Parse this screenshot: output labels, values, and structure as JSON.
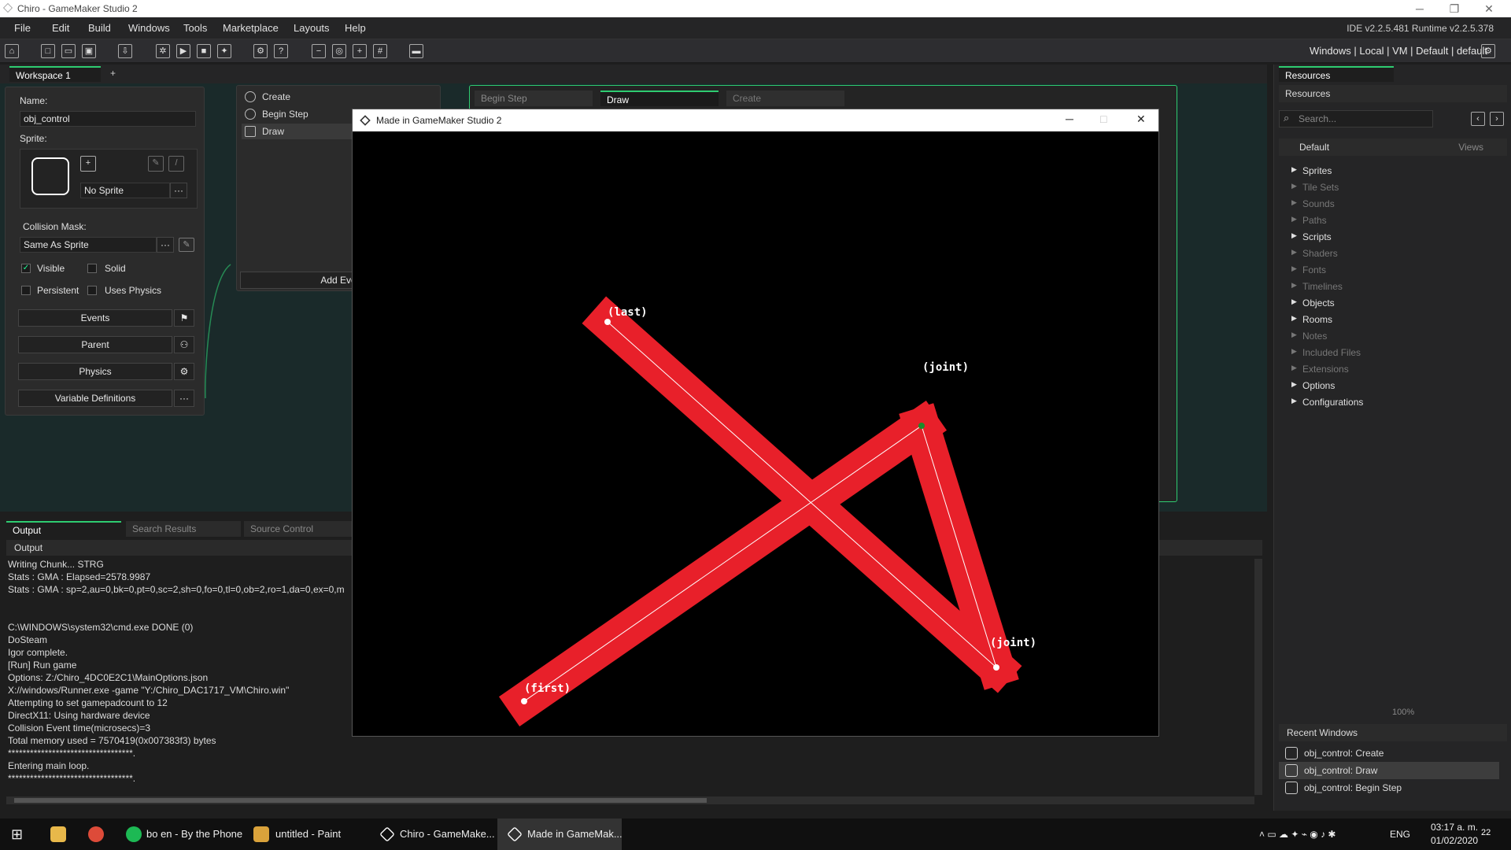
{
  "title_bar": {
    "title": "Chiro - GameMaker Studio 2",
    "minimize": "─",
    "maximize": "❐",
    "close": "✕"
  },
  "menu": {
    "items": [
      "File",
      "Edit",
      "Build",
      "Windows",
      "Tools",
      "Marketplace",
      "Layouts",
      "Help"
    ],
    "version": "IDE v2.2.5.481  Runtime v2.2.5.378"
  },
  "toolbar": {
    "target": "Windows  |  Local  |  VM  |  Default  |  default"
  },
  "workspace_tab": {
    "label": "Workspace 1",
    "add": "+"
  },
  "object_editor": {
    "name_label": "Name:",
    "name_value": "obj_control",
    "sprite_label": "Sprite:",
    "sprite_value": "No Sprite",
    "mask_label": "Collision Mask:",
    "mask_value": "Same As Sprite",
    "visible": "Visible",
    "solid": "Solid",
    "persistent": "Persistent",
    "uses_physics": "Uses Physics",
    "events_btn": "Events",
    "parent_btn": "Parent",
    "physics_btn": "Physics",
    "vardefs_btn": "Variable Definitions",
    "more": "···"
  },
  "events_list": {
    "items": [
      "Create",
      "Begin Step",
      "Draw"
    ],
    "add_event": "Add Eve"
  },
  "code_tabs": [
    {
      "label": "Begin Step"
    },
    {
      "label": "Draw"
    },
    {
      "label": "Create"
    }
  ],
  "game_window": {
    "title": "Made in GameMaker Studio 2",
    "labels": {
      "last": "(last)",
      "joint1": "(joint)",
      "joint2": "(joint)",
      "first": "(first)"
    },
    "shape_color": "#e8202a"
  },
  "output_panel": {
    "tabs": [
      "Output",
      "Search Results",
      "Source Control"
    ],
    "header": "Output",
    "lines": [
      "Writing Chunk... STRG",
      "Stats : GMA : Elapsed=2578.9987",
      "Stats : GMA : sp=2,au=0,bk=0,pt=0,sc=2,sh=0,fo=0,tl=0,ob=2,ro=1,da=0,ex=0,m",
      "",
      "",
      "C:\\WINDOWS\\system32\\cmd.exe DONE (0)",
      "DoSteam",
      "Igor complete.",
      "[Run] Run game",
      "Options: Z:/Chiro_4DC0E2C1\\MainOptions.json",
      "X://windows/Runner.exe  -game \"Y:/Chiro_DAC1717_VM\\Chiro.win\"",
      "Attempting to set gamepadcount to 12",
      "DirectX11: Using hardware device",
      "Collision Event time(microsecs)=3",
      "Total memory used = 7570419(0x007383f3) bytes",
      "**********************************.",
      "Entering main loop.",
      "**********************************."
    ]
  },
  "resources": {
    "tab": "Resources",
    "header": "Resources",
    "search_placeholder": "Search...",
    "group": "Default",
    "views": "Views",
    "items": [
      {
        "label": "Sprites",
        "on": true
      },
      {
        "label": "Tile Sets",
        "on": false
      },
      {
        "label": "Sounds",
        "on": false
      },
      {
        "label": "Paths",
        "on": false
      },
      {
        "label": "Scripts",
        "on": true
      },
      {
        "label": "Shaders",
        "on": false
      },
      {
        "label": "Fonts",
        "on": false
      },
      {
        "label": "Timelines",
        "on": false
      },
      {
        "label": "Objects",
        "on": true
      },
      {
        "label": "Rooms",
        "on": true
      },
      {
        "label": "Notes",
        "on": false
      },
      {
        "label": "Included Files",
        "on": false
      },
      {
        "label": "Extensions",
        "on": false
      },
      {
        "label": "Options",
        "on": true
      },
      {
        "label": "Configurations",
        "on": true
      }
    ],
    "zoom": "100%",
    "recent_header": "Recent Windows",
    "recent": [
      "obj_control: Create",
      "obj_control: Draw",
      "obj_control: Begin Step"
    ]
  },
  "taskbar": {
    "items": [
      "bo en - By the Phone",
      "untitled - Paint",
      "Chiro - GameMake...",
      "Made in GameMak..."
    ],
    "lang": "ENG",
    "time": "03:17 a. m.",
    "date": "01/02/2020",
    "notif": "22"
  }
}
